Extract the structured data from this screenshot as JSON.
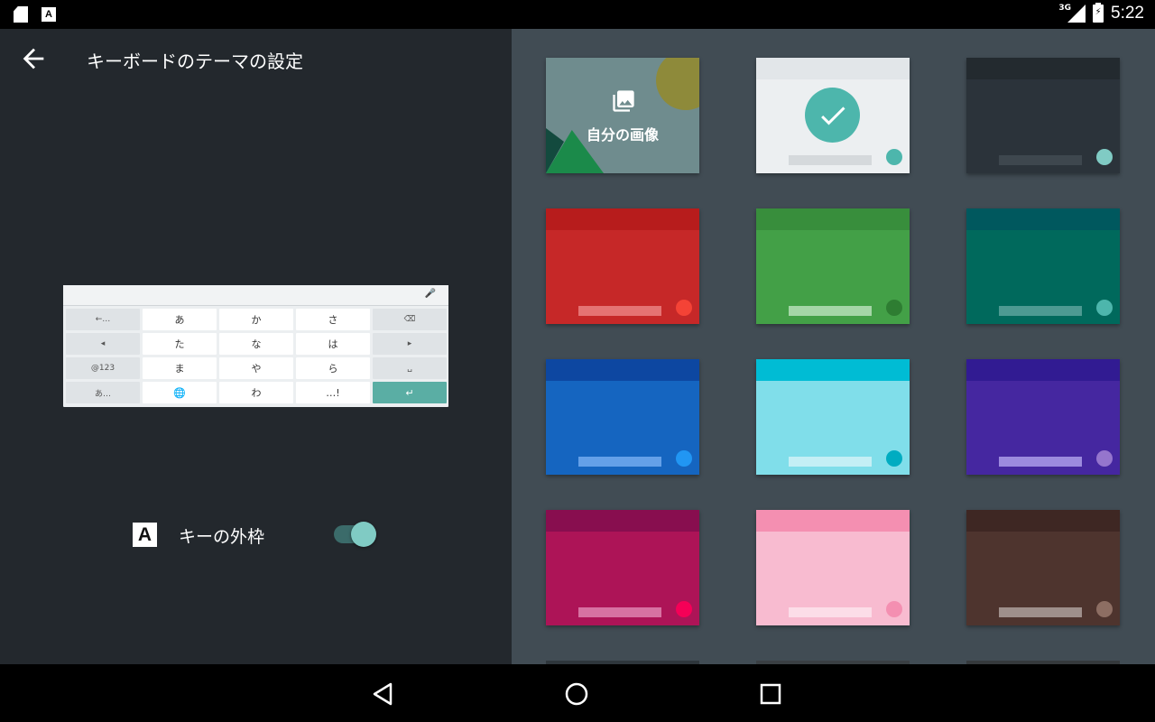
{
  "status": {
    "network": "3G",
    "time": "5:22",
    "left_icons": [
      "sd-card-icon",
      "font-a-icon"
    ]
  },
  "header": {
    "title": "キーボードのテーマの設定"
  },
  "preview": {
    "rows": [
      [
        "←…",
        "あ",
        "か",
        "さ",
        "⌫"
      ],
      [
        "◂",
        "た",
        "な",
        "は",
        "▸"
      ],
      [
        "@123",
        "ま",
        "や",
        "ら",
        "␣"
      ],
      [
        "あ…",
        "🌐",
        "わ",
        "…!",
        "↵"
      ]
    ]
  },
  "settings": {
    "key_outline_label": "キーの外枠",
    "key_outline_enabled": true
  },
  "themes": {
    "custom_image_label": "自分の画像",
    "selected": "light",
    "tiles": [
      {
        "id": "light",
        "bg": "#eceff1",
        "top": "#e2e6e9",
        "bar": "#d5d9dc",
        "dot": "#4db6ac"
      },
      {
        "id": "dark",
        "bg": "#2b333a",
        "top": "#232a2f",
        "bar": "#3e474e",
        "dot": "#80cbc4"
      },
      {
        "id": "red",
        "bg": "#c62828",
        "top": "#b71c1c",
        "bar": "#e57373",
        "dot": "#f44336"
      },
      {
        "id": "green",
        "bg": "#43a047",
        "top": "#388e3c",
        "bar": "#a5d6a7",
        "dot": "#2e7d32"
      },
      {
        "id": "teal",
        "bg": "#00695c",
        "top": "#00585e",
        "bar": "#4d9a92",
        "dot": "#4db6ac"
      },
      {
        "id": "blue",
        "bg": "#1565c0",
        "top": "#0d47a1",
        "bar": "#64a0e8",
        "dot": "#2196f3"
      },
      {
        "id": "cyan",
        "bg": "#80deea",
        "top": "#00bcd4",
        "bar": "#c4eff5",
        "dot": "#00acc1"
      },
      {
        "id": "purple",
        "bg": "#4527a0",
        "top": "#311b92",
        "bar": "#9c8ade",
        "dot": "#9575cd"
      },
      {
        "id": "magenta",
        "bg": "#ad1457",
        "top": "#880e4f",
        "bar": "#d772a2",
        "dot": "#f50057"
      },
      {
        "id": "pink",
        "bg": "#f8bbd0",
        "top": "#f48fb1",
        "bar": "#fcdde8",
        "dot": "#f48fb1"
      },
      {
        "id": "brown",
        "bg": "#4e342e",
        "top": "#3e2723",
        "bar": "#9e8f8b",
        "dot": "#8d6e63"
      }
    ]
  }
}
